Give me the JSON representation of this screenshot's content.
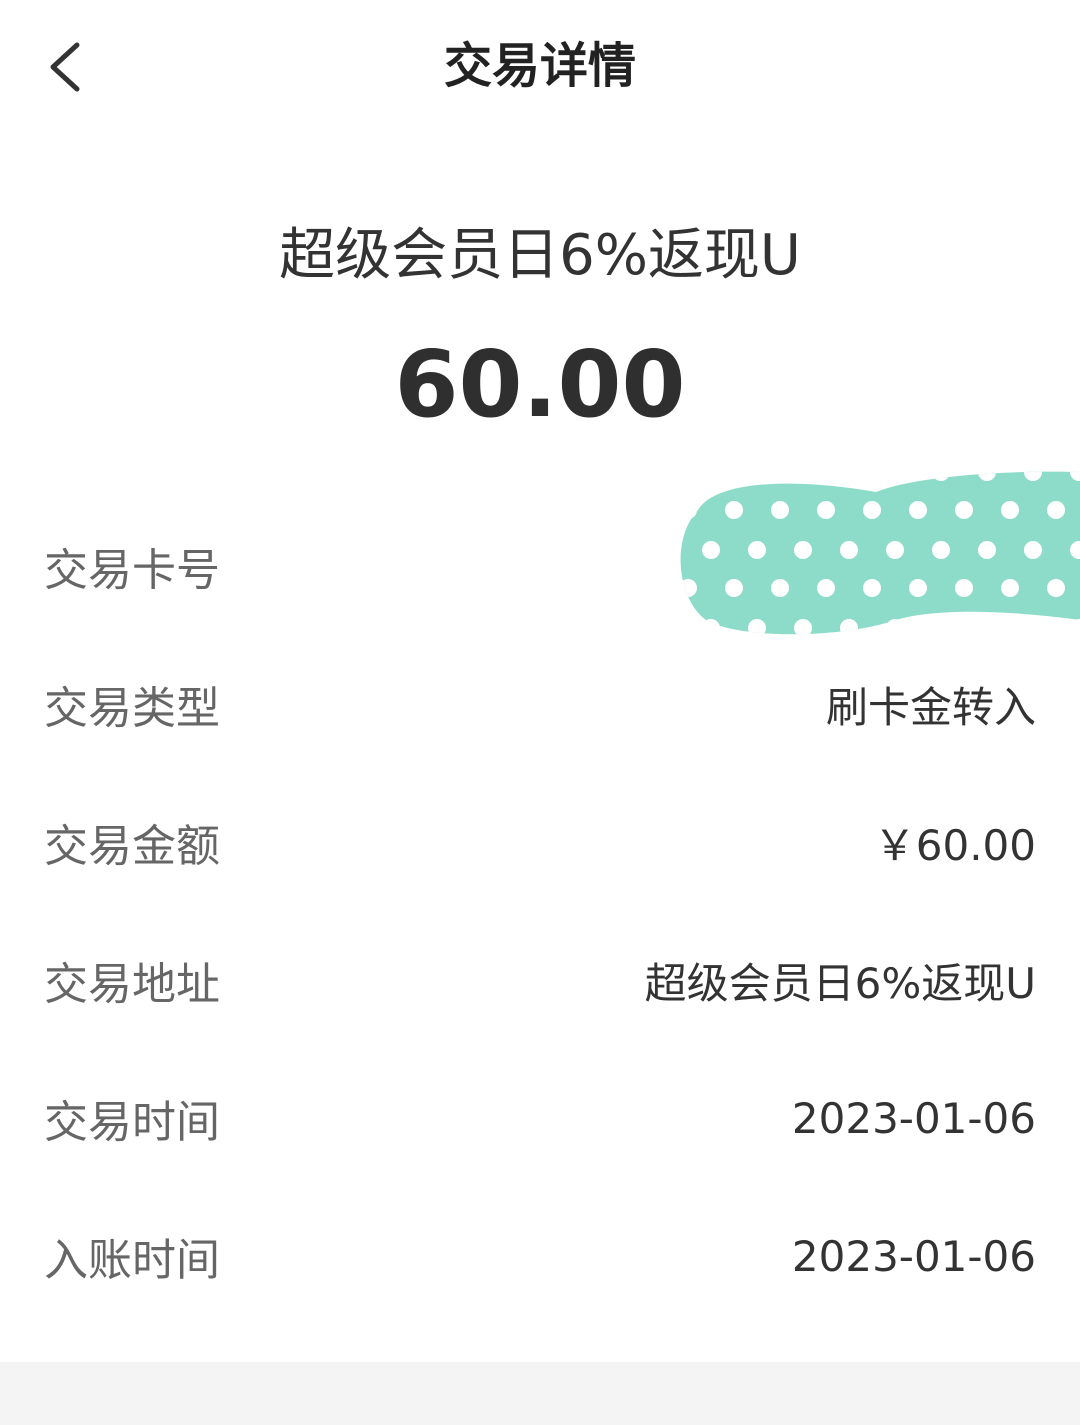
{
  "header": {
    "title": "交易详情",
    "back_icon": "chevron-left-icon"
  },
  "summary": {
    "merchant": "超级会员日6%返现U",
    "amount": "60.00"
  },
  "details": {
    "rows": [
      {
        "label": "交易卡号",
        "value": ""
      },
      {
        "label": "交易类型",
        "value": "刷卡金转入"
      },
      {
        "label": "交易金额",
        "value": "￥60.00"
      },
      {
        "label": "交易地址",
        "value": "超级会员日6%返现U"
      },
      {
        "label": "交易时间",
        "value": "2023-01-06"
      },
      {
        "label": "入账时间",
        "value": "2023-01-06"
      }
    ]
  },
  "colors": {
    "redaction": "#8ddcc9",
    "background": "#ffffff",
    "footer": "#f4f4f4"
  }
}
